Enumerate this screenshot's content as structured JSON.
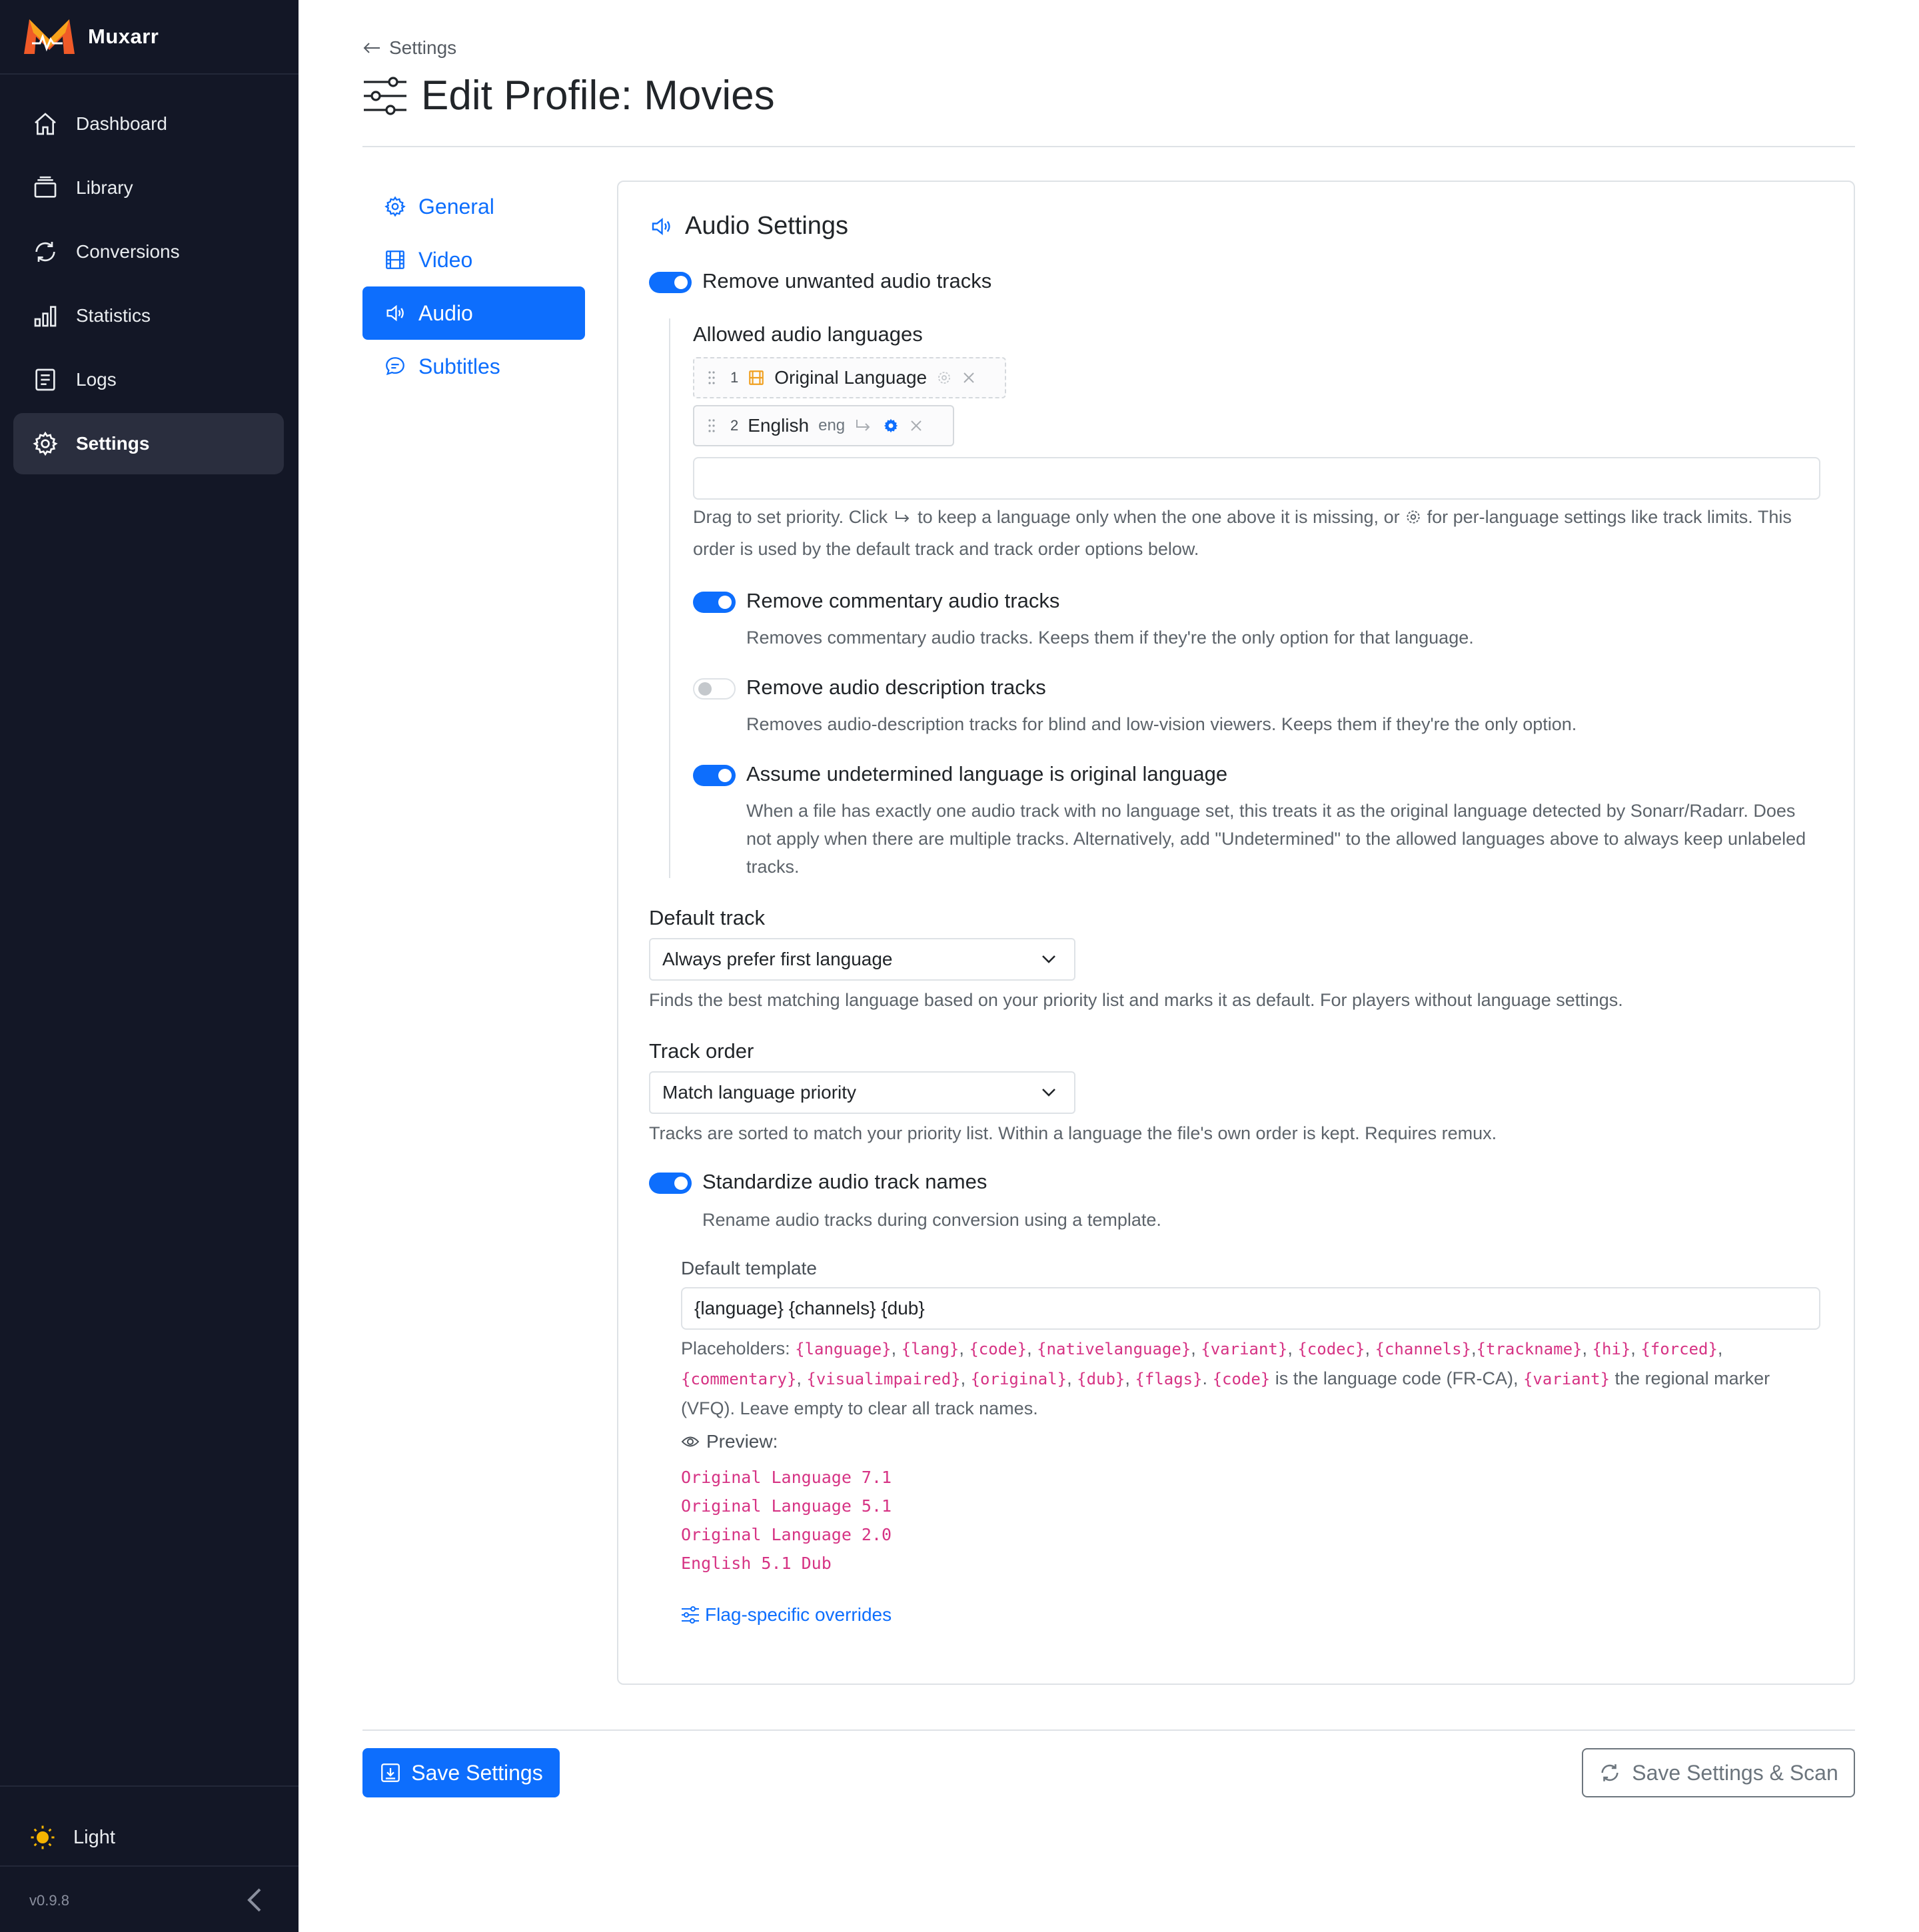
{
  "app": {
    "name": "Muxarr",
    "version": "v0.9.8",
    "theme_label": "Light",
    "accent_color": "#0d6efd",
    "sidebar_bg": "#131726"
  },
  "sidebar": {
    "items": [
      {
        "label": "Dashboard",
        "icon": "home-icon"
      },
      {
        "label": "Library",
        "icon": "library-icon"
      },
      {
        "label": "Conversions",
        "icon": "refresh-icon"
      },
      {
        "label": "Statistics",
        "icon": "bar-chart-icon"
      },
      {
        "label": "Logs",
        "icon": "log-icon"
      },
      {
        "label": "Settings",
        "icon": "gear-icon",
        "active": true
      }
    ]
  },
  "header": {
    "back_label": "Settings",
    "title": "Edit Profile: Movies"
  },
  "subnav": {
    "items": [
      {
        "label": "General",
        "icon": "gear-icon"
      },
      {
        "label": "Video",
        "icon": "film-icon"
      },
      {
        "label": "Audio",
        "icon": "speaker-icon",
        "active": true
      },
      {
        "label": "Subtitles",
        "icon": "chat-icon"
      }
    ]
  },
  "audio": {
    "section_title": "Audio Settings",
    "remove_unwanted": {
      "label": "Remove unwanted audio tracks",
      "enabled": true
    },
    "allowed_languages": {
      "label": "Allowed audio languages",
      "items": [
        {
          "priority": "1",
          "name": "Original Language",
          "code": ""
        },
        {
          "priority": "2",
          "name": "English",
          "code": "eng"
        }
      ],
      "add_placeholder": "",
      "help_pre": "Drag to set priority. Click",
      "help_mid": "to keep a language only when the one above it is missing, or",
      "help_post": "for per-language settings like track limits. This order is used by the default track and track order options below."
    },
    "remove_commentary": {
      "label": "Remove commentary audio tracks",
      "enabled": true,
      "help": "Removes commentary audio tracks. Keeps them if they're the only option for that language."
    },
    "remove_description": {
      "label": "Remove audio description tracks",
      "enabled": false,
      "help": "Removes audio-description tracks for blind and low-vision viewers. Keeps them if they're the only option."
    },
    "assume_undetermined": {
      "label": "Assume undetermined language is original language",
      "enabled": true,
      "help": "When a file has exactly one audio track with no language set, this treats it as the original language detected by Sonarr/Radarr. Does not apply when there are multiple tracks. Alternatively, add \"Undetermined\" to the allowed languages above to always keep unlabeled tracks."
    },
    "default_track": {
      "label": "Default track",
      "value": "Always prefer first language",
      "help": "Finds the best matching language based on your priority list and marks it as default. For players without language settings."
    },
    "track_order": {
      "label": "Track order",
      "value": "Match language priority",
      "help": "Tracks are sorted to match your priority list. Within a language the file's own order is kept. Requires remux."
    },
    "standardize": {
      "label": "Standardize audio track names",
      "enabled": true,
      "help": "Rename audio tracks during conversion using a template.",
      "template_label": "Default template",
      "template_value": "{language} {channels} {dub}",
      "placeholders_prefix": "Placeholders:",
      "placeholders": [
        "{language}",
        "{lang}",
        "{code}",
        "{nativelanguage}",
        "{variant}",
        "{codec}",
        "{channels}",
        "{trackname}",
        "{hi}",
        "{forced}",
        "{commentary}",
        "{visualimpaired}",
        "{original}",
        "{dub}",
        "{flags}"
      ],
      "code_token": "{code}",
      "code_desc": "is the language code (FR-CA),",
      "variant_token": "{variant}",
      "variant_desc": "the regional marker (VFQ). Leave empty to clear all track names.",
      "preview_label": "Preview:",
      "preview": [
        "Original Language 7.1",
        "Original Language 5.1",
        "Original Language 2.0",
        "English 5.1 Dub"
      ],
      "overrides_link": "Flag-specific overrides"
    }
  },
  "actions": {
    "save": "Save Settings",
    "save_scan": "Save Settings & Scan"
  }
}
